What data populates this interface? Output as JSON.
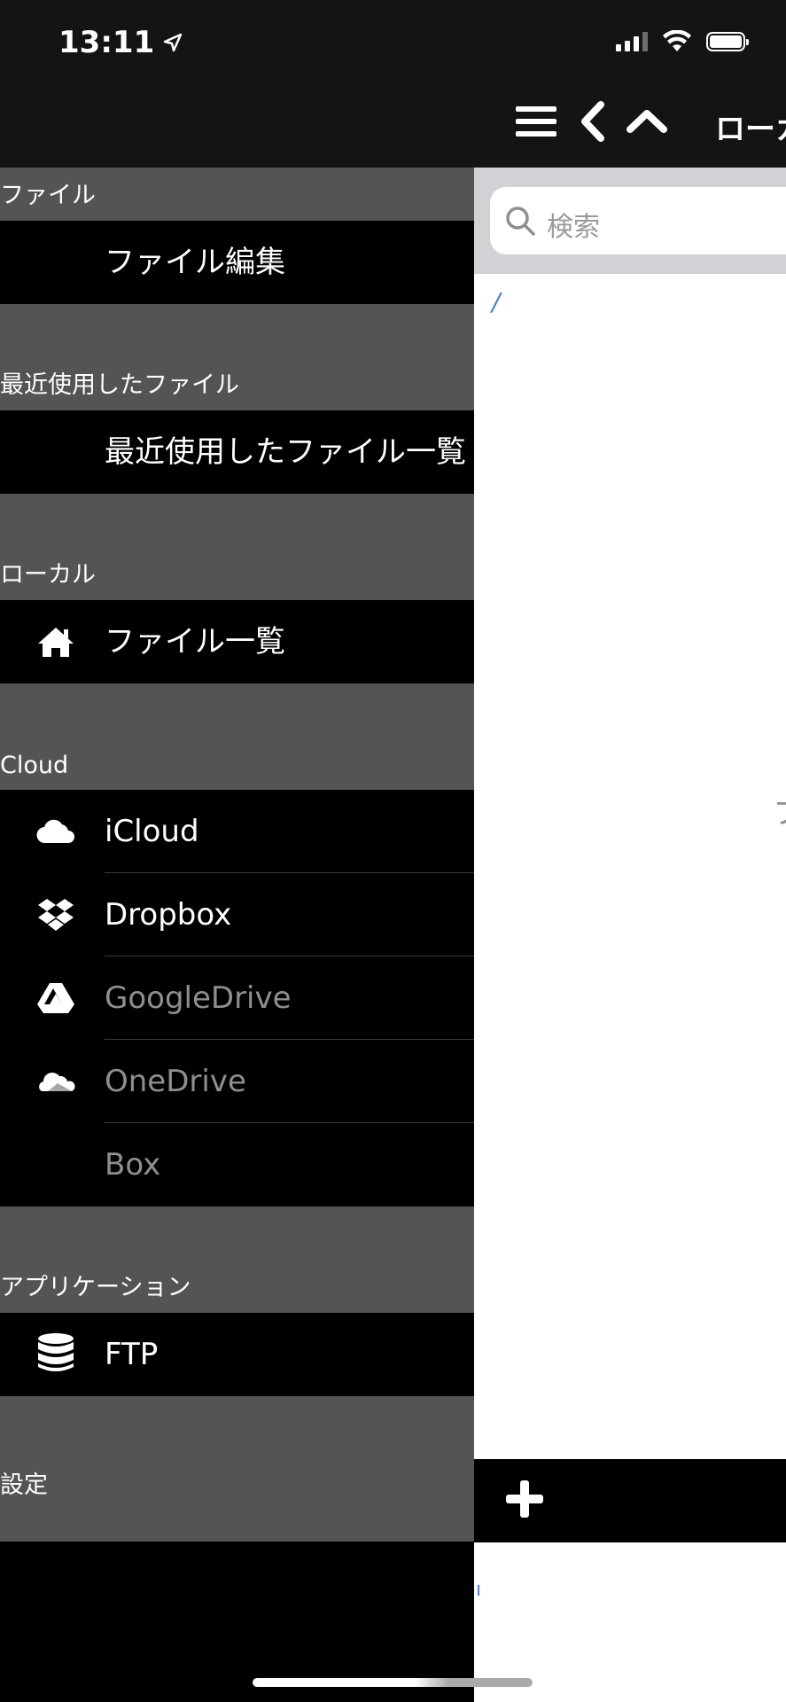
{
  "status_bar": {
    "time": "13:11"
  },
  "main": {
    "title": "ローカ",
    "search_placeholder": "検索",
    "path": "/",
    "edge_glyph": "フ",
    "add_label": "+"
  },
  "drawer": {
    "sections": [
      {
        "header": "ファイル",
        "items": [
          {
            "label": "ファイル編集",
            "icon": "none",
            "enabled": true
          }
        ]
      },
      {
        "header": "最近使用したファイル",
        "items": [
          {
            "label": "最近使用したファイル一覧",
            "icon": "none",
            "enabled": true
          }
        ]
      },
      {
        "header": "ローカル",
        "items": [
          {
            "label": "ファイル一覧",
            "icon": "home-icon",
            "enabled": true
          }
        ]
      },
      {
        "header": "Cloud",
        "items": [
          {
            "label": "iCloud",
            "icon": "cloud-icon",
            "enabled": true
          },
          {
            "label": "Dropbox",
            "icon": "dropbox-icon",
            "enabled": true
          },
          {
            "label": "GoogleDrive",
            "icon": "google-drive-icon",
            "enabled": false
          },
          {
            "label": "OneDrive",
            "icon": "onedrive-icon",
            "enabled": false
          },
          {
            "label": "Box",
            "icon": "none",
            "enabled": false
          }
        ]
      },
      {
        "header": "アプリケーション",
        "items": [
          {
            "label": "FTP",
            "icon": "database-icon",
            "enabled": true
          }
        ]
      },
      {
        "header": "設定",
        "items": []
      }
    ]
  },
  "colors": {
    "drawer_bg": "#000000",
    "section_header_bg": "#545454",
    "topbar_bg": "#141414",
    "disabled_text": "#8e8e93",
    "path_link": "#4a80d6"
  }
}
